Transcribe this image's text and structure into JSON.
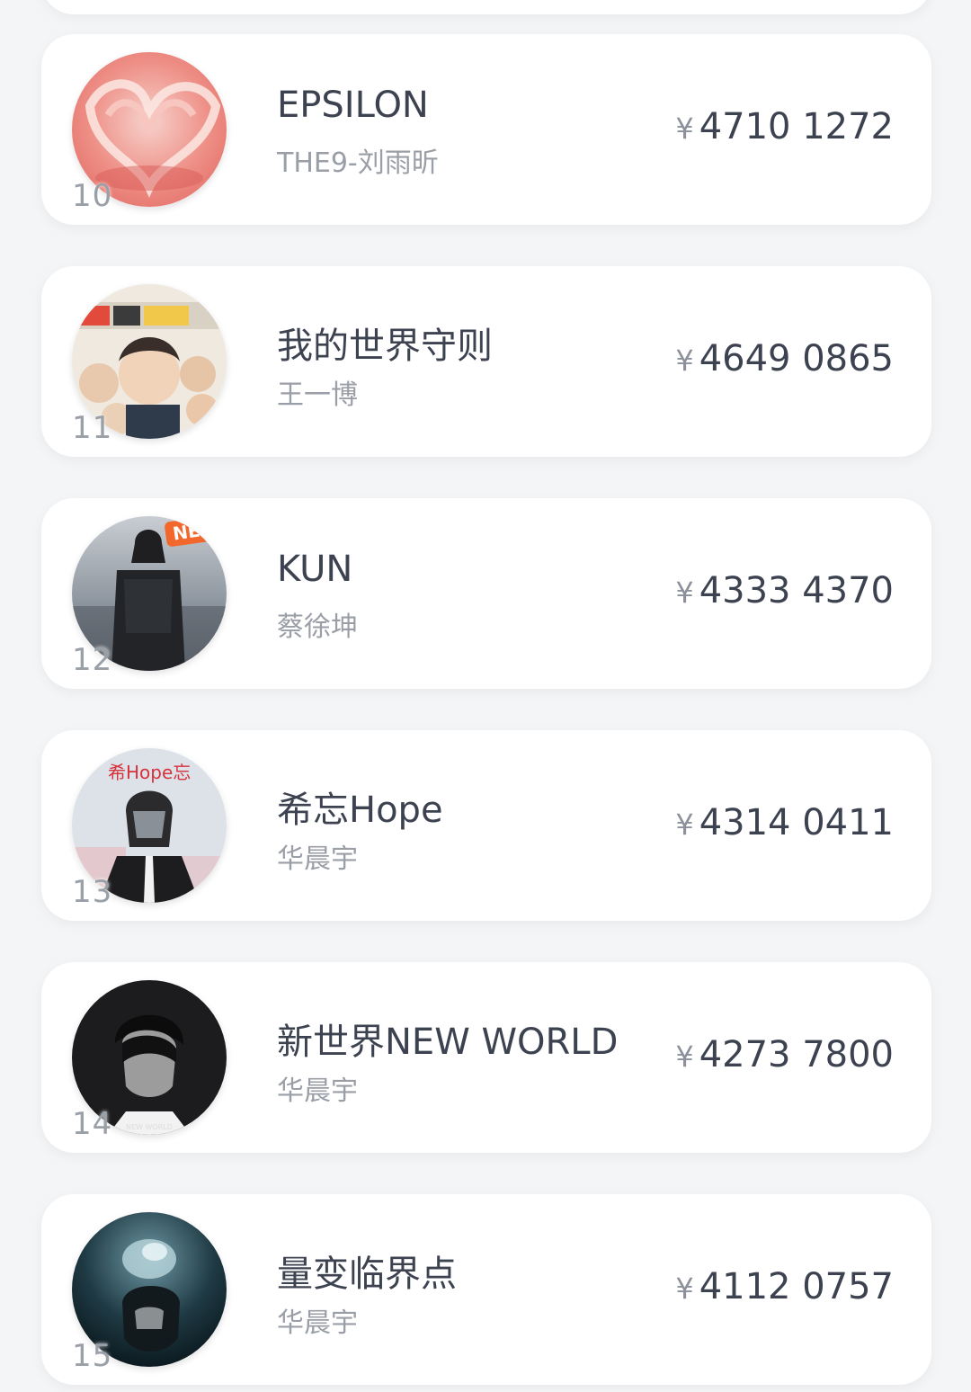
{
  "items": [
    {
      "rank": "10",
      "title": "EPSILON",
      "artist": "THE9-刘雨昕",
      "currency": "¥",
      "amount": "4710 1272",
      "cover": "heart-swirl-cover"
    },
    {
      "rank": "11",
      "title": "我的世界守则",
      "artist": "王一博",
      "currency": "¥",
      "amount": "4649 0865",
      "cover": "collage-cover"
    },
    {
      "rank": "12",
      "title": "KUN",
      "artist": "蔡徐坤",
      "currency": "¥",
      "amount": "4333 4370",
      "cover": "seaside-portrait-cover",
      "badge": "NEW"
    },
    {
      "rank": "13",
      "title": "希忘Hope",
      "artist": "华晨宇",
      "currency": "¥",
      "amount": "4314 0411",
      "cover": "masked-figure-cover",
      "cover_text": "希Hope忘"
    },
    {
      "rank": "14",
      "title": "新世界NEW WORLD",
      "artist": "华晨宇",
      "currency": "¥",
      "amount": "4273 7800",
      "cover": "bw-portrait-cover",
      "cover_text": "NEW WORLD"
    },
    {
      "rank": "15",
      "title": "量变临界点",
      "artist": "华晨宇",
      "currency": "¥",
      "amount": "4112 0757",
      "cover": "dark-teal-cover"
    }
  ]
}
